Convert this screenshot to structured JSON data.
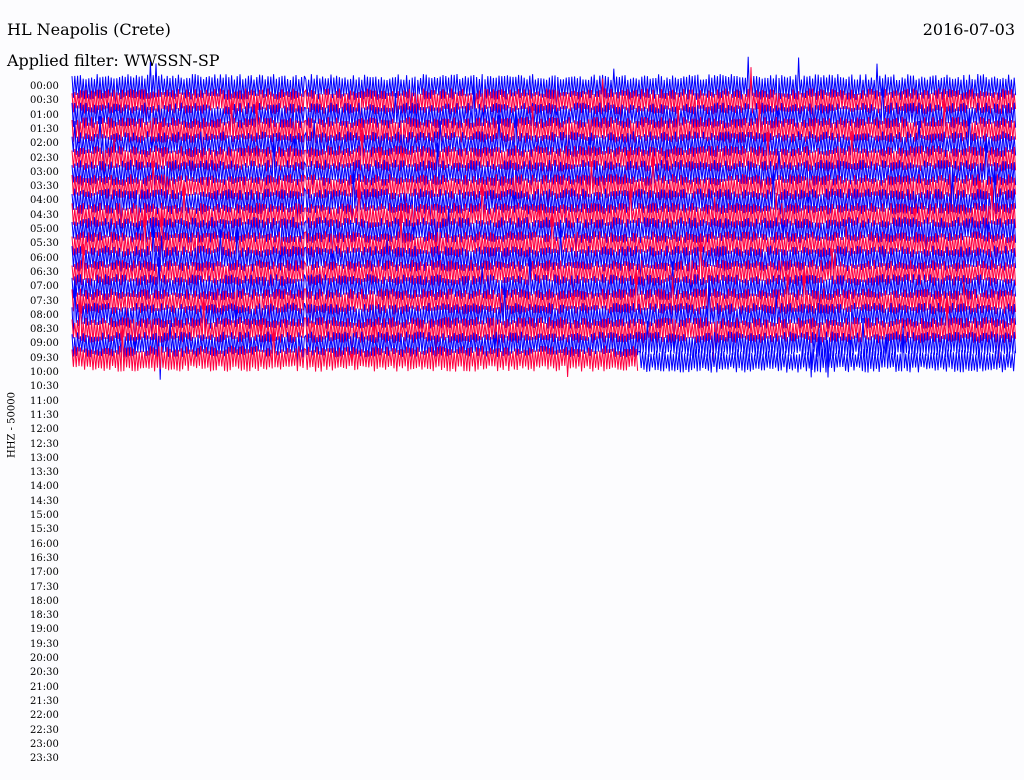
{
  "header": {
    "station": "HL Neapolis (Crete)",
    "date": "2016-07-03",
    "filter": "Applied filter: WWSSN-SP"
  },
  "chart_data": {
    "type": "line",
    "title": "HL Neapolis (Crete)",
    "ylabel": "HHZ - 50000",
    "tick_labels": [
      "00:00",
      "00:30",
      "01:00",
      "01:30",
      "02:00",
      "02:30",
      "03:00",
      "03:30",
      "04:00",
      "04:30",
      "05:00",
      "05:30",
      "06:00",
      "06:30",
      "07:00",
      "07:30",
      "08:00",
      "08:30",
      "09:00",
      "09:30",
      "10:00",
      "10:30",
      "11:00",
      "11:30",
      "12:00",
      "12:30",
      "13:00",
      "13:30",
      "14:00",
      "14:30",
      "15:00",
      "15:30",
      "16:00",
      "16:30",
      "17:00",
      "17:30",
      "18:00",
      "18:30",
      "19:00",
      "19:30",
      "20:00",
      "20:30",
      "21:00",
      "21:30",
      "22:00",
      "22:30",
      "23:00",
      "23:30"
    ],
    "trace_colors": [
      "#0000ff",
      "#ff0040"
    ],
    "recorded_rows": 20,
    "last_row_recorded_fraction": 0.6,
    "x_axis_minutes_per_row": 30
  }
}
